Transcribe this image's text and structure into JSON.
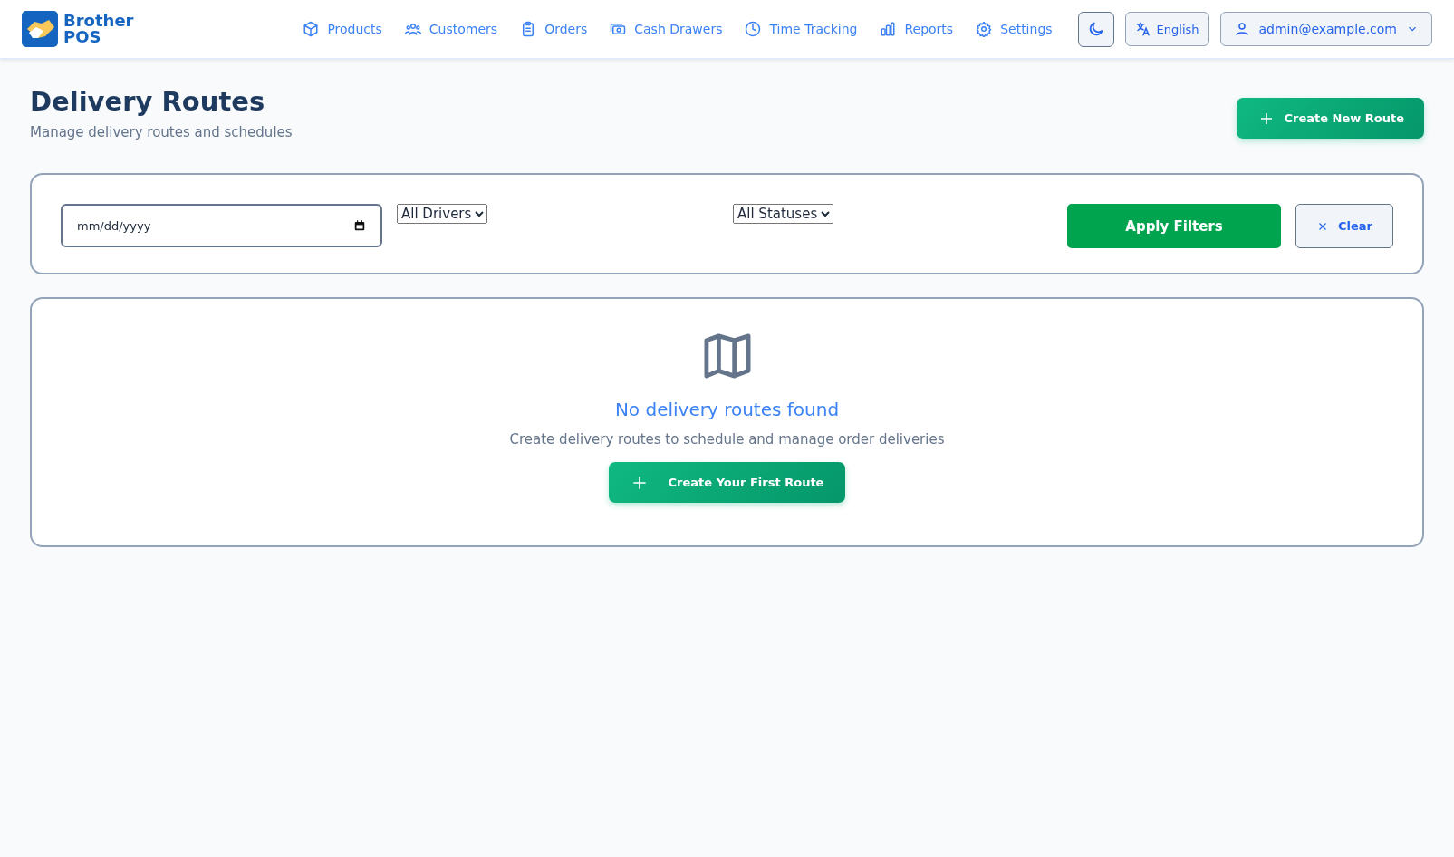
{
  "brand": {
    "line_1": "Brother",
    "line_2": "POS"
  },
  "nav": [
    {
      "label": "Products",
      "kind": "box"
    },
    {
      "label": "Customers",
      "kind": "users"
    },
    {
      "label": "Orders",
      "kind": "clipboard"
    },
    {
      "label": "Cash Drawers",
      "kind": "cash"
    },
    {
      "label": "Time Tracking",
      "kind": "clock"
    },
    {
      "label": "Reports",
      "kind": "chart"
    },
    {
      "label": "Settings",
      "kind": "gear"
    }
  ],
  "language": "English",
  "user": "admin@example.com",
  "page": {
    "title": "Delivery Routes",
    "subtitle": "Manage delivery routes and schedules",
    "create_button": "Create New Route"
  },
  "filters": {
    "date": {
      "placeholder": "mm/dd/yyyy"
    },
    "driver": "All Drivers",
    "status": "All Statuses",
    "apply": "Apply Filters",
    "clear": "Clear"
  },
  "empty_state": {
    "title": "No delivery routes found",
    "message": "Create delivery routes to schedule and manage order deliveries",
    "button": "Create Your First Route"
  }
}
